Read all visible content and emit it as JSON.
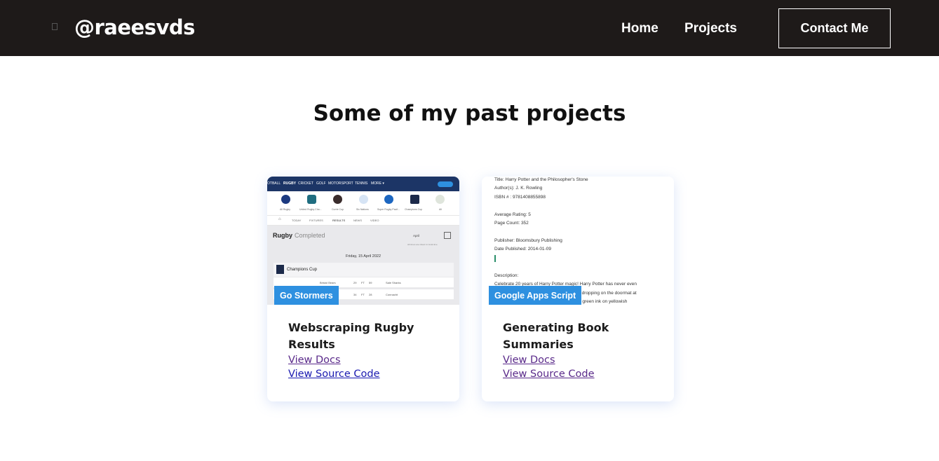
{
  "nav": {
    "brand": "@raeesvds",
    "links": [
      {
        "label": "Home"
      },
      {
        "label": "Projects"
      }
    ],
    "contact_label": "Contact Me"
  },
  "main": {
    "section_title": "Some of my past projects"
  },
  "projects": [
    {
      "tag": "Go Stormers",
      "title": "Webscraping Rugby Results",
      "docs_label": "View Docs",
      "source_label": "View Source Code",
      "thumbnail": {
        "top_nav": [
          "OTBALL",
          "RUGBY",
          "CRICKET",
          "GOLF",
          "MOTORSPORT",
          "TENNIS",
          "MORE ▾"
        ],
        "competitions": [
          "All Rugby",
          "United Rugby Cha...",
          "Currie Cup",
          "Six Nations",
          "Super Rugby Pacif...",
          "Champions Cup",
          "All"
        ],
        "tabs": [
          "TODAY",
          "FIXTURES",
          "RESULTS",
          "NEWS",
          "VIDEO"
        ],
        "sport": "Rugby",
        "status": "Completed",
        "month": "April",
        "timezone_note": "All times are shown in local time",
        "date": "Friday, 15 April 2022",
        "competition": "Champions Cup",
        "rows": [
          {
            "home": "Bristol Bears",
            "home_score": "29",
            "status": "FT",
            "away_score": "59",
            "away": "Sale Sharks"
          },
          {
            "home": "",
            "home_score": "34",
            "status": "FT",
            "away_score": "28",
            "away": "Connacht"
          }
        ]
      }
    },
    {
      "tag": "Google Apps Script",
      "title": "Generating Book Summaries",
      "docs_label": "View Docs",
      "source_label": "View Source Code",
      "thumbnail": {
        "lines": [
          "Title: Harry Potter and the Philosopher's Stone",
          "Author(s): J. K. Rowling",
          "ISBN # : 9781408855898",
          "Average Rating: 5",
          "Page Count: 352",
          "Publisher: Bloomsbury Publishing",
          "Date Published: 2014-01-09",
          "Description:",
          "Celebrate 20 years of Harry Potter magic! Harry Potter has never even",
          "rs start dropping on the doormat at",
          "ssed in green ink on yellowish"
        ]
      }
    }
  ],
  "colors": {
    "navbar_bg": "#1e1a19",
    "tag_bg": "#2e90e0",
    "link_visited": "#5a2a8a",
    "link_unvisited": "#1a1ab0"
  }
}
